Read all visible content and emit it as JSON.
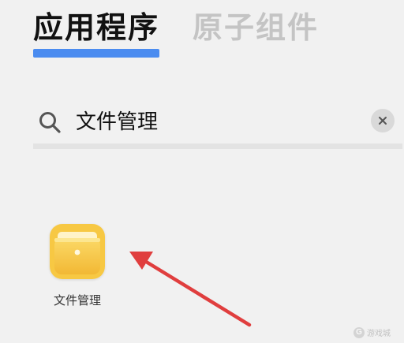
{
  "tabs": [
    {
      "label": "应用程序",
      "active": true
    },
    {
      "label": "原子组件",
      "active": false
    }
  ],
  "search": {
    "query": "文件管理",
    "icon": "search-icon",
    "clear_icon": "close-icon"
  },
  "results": [
    {
      "label": "文件管理",
      "icon": "folder-icon"
    }
  ],
  "annotation": {
    "type": "arrow",
    "color": "#e03e3e",
    "points_to": "文件管理"
  },
  "watermark": {
    "badge": "G",
    "text": "游戏城"
  },
  "colors": {
    "accent": "#4b8cf0",
    "background": "#f1f1f1",
    "tab_active": "#111111",
    "tab_inactive": "#c4c4c4",
    "folder": "#f7c843"
  }
}
